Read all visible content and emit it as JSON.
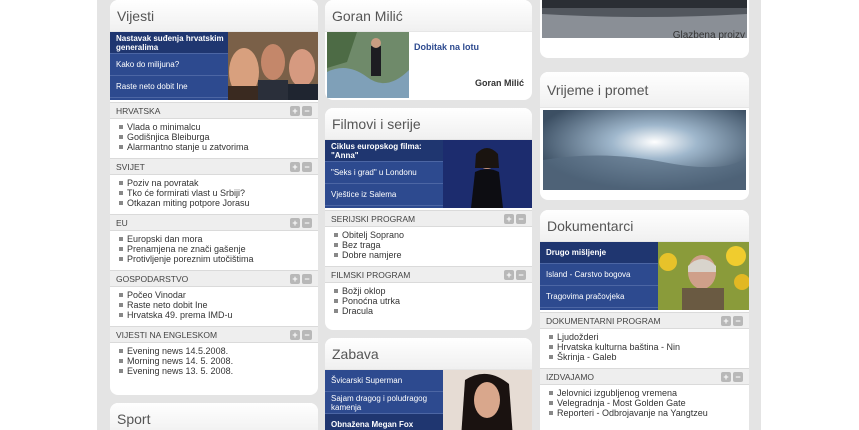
{
  "vijesti": {
    "title": "Vijesti",
    "promo": [
      "Nastavak suđenja hrvatskim generalima",
      "Kako do milijuna?",
      "Raste neto dobit Ine"
    ],
    "sections": [
      {
        "label": "HRVATSKA",
        "items": [
          "Vlada o minimalcu",
          "Godišnjica Bleiburga",
          "Alarmantno stanje u zatvorima"
        ]
      },
      {
        "label": "SVIJET",
        "items": [
          "Poziv na povratak",
          "Tko će formirati vlast u Srbiji?",
          "Otkazan miting potpore Jorasu"
        ]
      },
      {
        "label": "EU",
        "items": [
          "Europski dan mora",
          "Prenamjena ne znači gašenje",
          "Protivljenje poreznim utočištima"
        ]
      },
      {
        "label": "GOSPODARSTVO",
        "items": [
          "Počeo Vinodar",
          "Raste neto dobit Ine",
          "Hrvatska 49. prema IMD-u"
        ]
      },
      {
        "label": "VIJESTI NA ENGLESKOM",
        "items": [
          "Evening news 14.5.2008.",
          "Morning news 14. 5. 2008.",
          "Evening news 13. 5. 2008."
        ]
      }
    ]
  },
  "sport": {
    "title": "Sport"
  },
  "goran": {
    "title": "Goran Milić",
    "link": "Dobitak na lotu",
    "author": "Goran Milić"
  },
  "filmovi": {
    "title": "Filmovi i serije",
    "promo": [
      "Ciklus europskog filma: \"Anna\"",
      "\"Seks i grad\" u Londonu",
      "Vještice iz Salema"
    ],
    "sections": [
      {
        "label": "SERIJSKI PROGRAM",
        "items": [
          "Obitelj Soprano",
          "Bez traga",
          "Dobre namjere"
        ]
      },
      {
        "label": "FILMSKI PROGRAM",
        "items": [
          "Božji oklop",
          "Ponoćna utrka",
          "Dracula"
        ]
      }
    ]
  },
  "zabava": {
    "title": "Zabava",
    "promo": [
      "Švicarski Superman",
      "Sajam dragog i poludragog kamenja",
      "Obnažena Megan Fox"
    ]
  },
  "glazbena": {
    "caption": "Glazbena proizv"
  },
  "vrijeme": {
    "title": "Vrijeme i promet"
  },
  "dokumentarci": {
    "title": "Dokumentarci",
    "promo": [
      "Drugo mišljenje",
      "Island - Carstvo bogova",
      "Tragovima pračovjeka"
    ],
    "sections": [
      {
        "label": "DOKUMENTARNI PROGRAM",
        "items": [
          "Ljudožderi",
          "Hrvatska kulturna baština - Nin",
          "Škrinja - Galeb"
        ]
      },
      {
        "label": "IZDVAJAMO",
        "items": [
          "Jelovnici izgubljenog vremena",
          "Velegradnja - Most Golden Gate",
          "Reporteri - Odbrojavanje na Yangtzeu"
        ]
      }
    ]
  },
  "controls": {
    "plus": "+",
    "minus": "−"
  }
}
